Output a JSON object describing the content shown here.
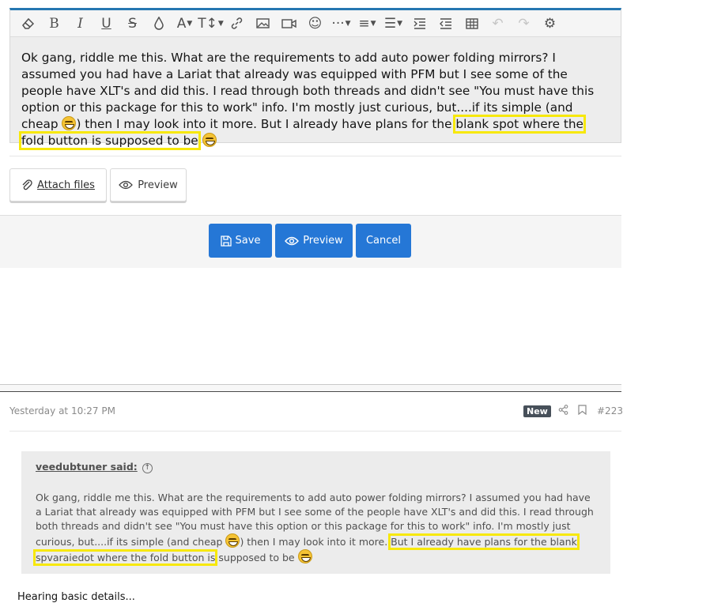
{
  "toolbar": {
    "icons": [
      "eraser-icon",
      "bold-icon",
      "italic-icon",
      "underline-icon",
      "strikethrough-icon",
      "text-color-icon",
      "font-family-icon",
      "font-size-icon",
      "link-icon",
      "image-icon",
      "media-icon",
      "smilie-icon",
      "more-icon",
      "align-icon",
      "list-icon",
      "indent-icon",
      "outdent-icon",
      "table-icon",
      "undo-icon",
      "redo-icon",
      "settings-icon"
    ]
  },
  "editor": {
    "text_before": "Ok gang, riddle me this. What are the requirements to add auto power folding mirrors? I assumed you had have a Lariat that already was equipped with PFM but I see some of the people have XLT's and did this. I read through both threads and didn't see \"You must have this option or this package for this to work\" info. I'm mostly just curious, but....if its simple (and cheap ",
    "text_middle": ") then I may look into it more. But I already have plans for the ",
    "text_highlight": "blank spot where the fold button is supposed to be",
    "highlight_color": "#f7e80a"
  },
  "actions": {
    "attach_label": "Attach files",
    "preview_label": "Preview"
  },
  "form": {
    "save_label": "Save",
    "preview_label": "Preview",
    "cancel_label": "Cancel",
    "button_color": "#2577d6"
  },
  "post": {
    "time": "Yesterday at 10:27 PM",
    "badge": "New",
    "number": "#223",
    "quote_author": "veedubtuner said:",
    "quote_before": "Ok gang, riddle me this. What are the requirements to add auto power folding mirrors? I assumed you had have a Lariat that already was equipped with PFM but I see some of the people have XLT's and did this. I read through both threads and didn't see \"You must have this option or this package for this to work\" info. I'm mostly just curious, but....if its simple (and cheap ",
    "quote_middle": ") then I may look into it more. ",
    "quote_highlight": "But I already have plans for the blank spvaraiedot where the fold button is",
    "quote_after": " supposed to be ",
    "body_preview": "Hearing basic details..."
  }
}
